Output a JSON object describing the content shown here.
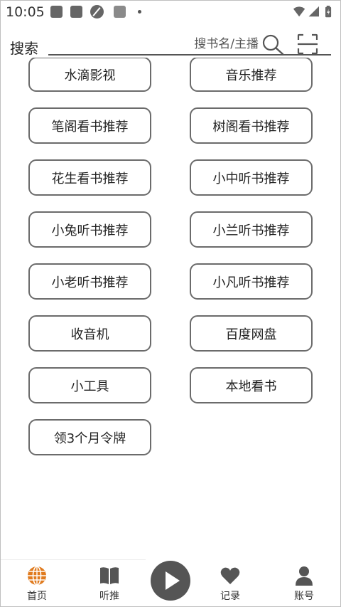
{
  "status_bar": {
    "time": "10:05",
    "icons": [
      "notification-square-icon",
      "notification-square-icon",
      "no-tracking-icon",
      "notification-square-icon",
      "dot-icon",
      "wifi-icon",
      "signal-icon",
      "battery-charging-icon"
    ]
  },
  "search": {
    "label": "搜索",
    "placeholder": "搜书名/主播",
    "search_icon": "search-icon",
    "scan_icon": "scan-icon"
  },
  "menu": {
    "items": [
      {
        "label": "水滴影视"
      },
      {
        "label": "音乐推荐"
      },
      {
        "label": "笔阁看书推荐"
      },
      {
        "label": "树阁看书推荐"
      },
      {
        "label": "花生看书推荐"
      },
      {
        "label": "小中听书推荐"
      },
      {
        "label": "小兔听书推荐"
      },
      {
        "label": "小兰听书推荐"
      },
      {
        "label": "小老听书推荐"
      },
      {
        "label": "小凡听书推荐"
      },
      {
        "label": "收音机"
      },
      {
        "label": "百度网盘"
      },
      {
        "label": "小工具"
      },
      {
        "label": "本地看书"
      },
      {
        "label": "领3个月令牌"
      }
    ]
  },
  "bottom_nav": {
    "items": [
      {
        "label": "首页",
        "icon": "globe-icon",
        "active": true
      },
      {
        "label": "听推",
        "icon": "book-icon"
      },
      {
        "label": "记录",
        "icon": "heart-icon"
      },
      {
        "label": "账号",
        "icon": "person-icon"
      }
    ],
    "play_icon": "play-icon"
  },
  "colors": {
    "accent": "#e07b1f",
    "button_border": "#6b6b6b",
    "icon_gray": "#555555"
  }
}
